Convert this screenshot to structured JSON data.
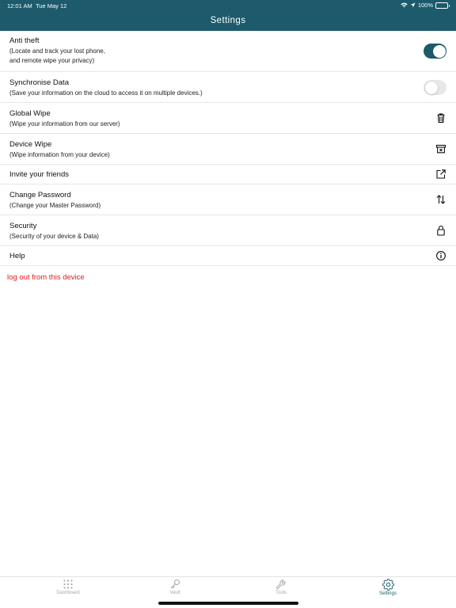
{
  "status_bar": {
    "time": "12:01 AM",
    "date": "Tue May 12",
    "battery": "100%"
  },
  "header": {
    "title": "Settings"
  },
  "colors": {
    "brand": "#1c5a6c",
    "logout": "#e11b1b"
  },
  "settings": [
    {
      "label": "Anti theft",
      "subtitle_lines": [
        "(Locate and track your lost phone,",
        "and remote wipe your privacy)"
      ],
      "control": "toggle",
      "enabled": true
    },
    {
      "label": "Synchronise Data",
      "subtitle_lines": [
        "(Save your information on the cloud to access it on multiple devices.)"
      ],
      "control": "toggle",
      "enabled": false
    },
    {
      "label": "Global Wipe",
      "subtitle_lines": [
        "(Wipe your information from our server)"
      ],
      "control": "trash-icon"
    },
    {
      "label": "Device Wipe",
      "subtitle_lines": [
        "(Wipe information from your device)"
      ],
      "control": "wipe-box-icon"
    },
    {
      "label": "Invite your friends",
      "subtitle_lines": [],
      "control": "share-external-icon"
    },
    {
      "label": "Change Password",
      "subtitle_lines": [
        "(Change your Master Password)"
      ],
      "control": "swap-arrows-icon"
    },
    {
      "label": "Security",
      "subtitle_lines": [
        "(Security of your device & Data)"
      ],
      "control": "lock-icon"
    },
    {
      "label": "Help",
      "subtitle_lines": [],
      "control": "info-icon"
    }
  ],
  "logout_label": "log out from this device",
  "tabbar": {
    "tabs": [
      {
        "label": "Dashboard",
        "icon": "grid-dots-icon",
        "active": false
      },
      {
        "label": "Vault",
        "icon": "key-icon",
        "active": false
      },
      {
        "label": "Tools",
        "icon": "wrench-icon",
        "active": false
      },
      {
        "label": "Settings",
        "icon": "gear-icon",
        "active": true
      }
    ]
  }
}
